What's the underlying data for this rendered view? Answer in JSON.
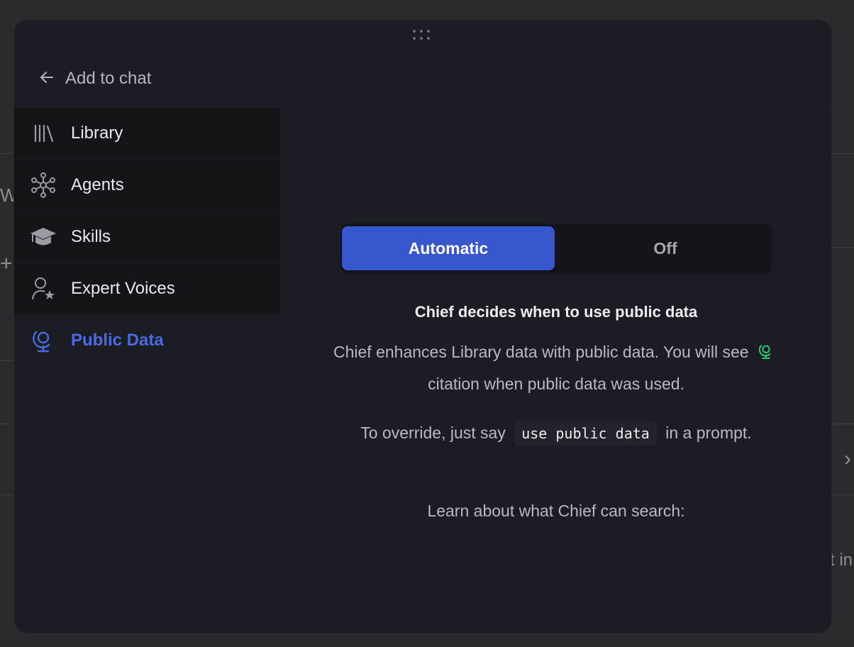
{
  "background": {
    "fragment_left_letter": "W",
    "fragment_plus": "+",
    "fragment_chevron": "›",
    "fragment_right_text": "t in"
  },
  "header": {
    "back_label": "Add to chat",
    "back_icon": "arrow-left-icon"
  },
  "sidebar": {
    "items": [
      {
        "label": "Library",
        "icon": "library-icon"
      },
      {
        "label": "Agents",
        "icon": "network-icon"
      },
      {
        "label": "Skills",
        "icon": "graduation-cap-icon"
      },
      {
        "label": "Expert Voices",
        "icon": "user-star-icon"
      },
      {
        "label": "Public Data",
        "icon": "globe-stand-icon",
        "active": true
      }
    ]
  },
  "content": {
    "toggle": {
      "options": [
        "Automatic",
        "Off"
      ],
      "selected": "Automatic"
    },
    "headline": "Chief decides when to use public data",
    "description_part1": "Chief enhances Library data with public data. You will see",
    "description_part2": "citation when public data was used.",
    "override_before": "To override, just say",
    "override_code": "use public data",
    "override_after": "in a prompt.",
    "learn_more": "Learn about what Chief can search:"
  },
  "colors": {
    "accent": "#3957cc",
    "active_text": "#4b6ae0",
    "citation_icon": "#2fc46a",
    "modal_bg": "#1c1d24"
  }
}
